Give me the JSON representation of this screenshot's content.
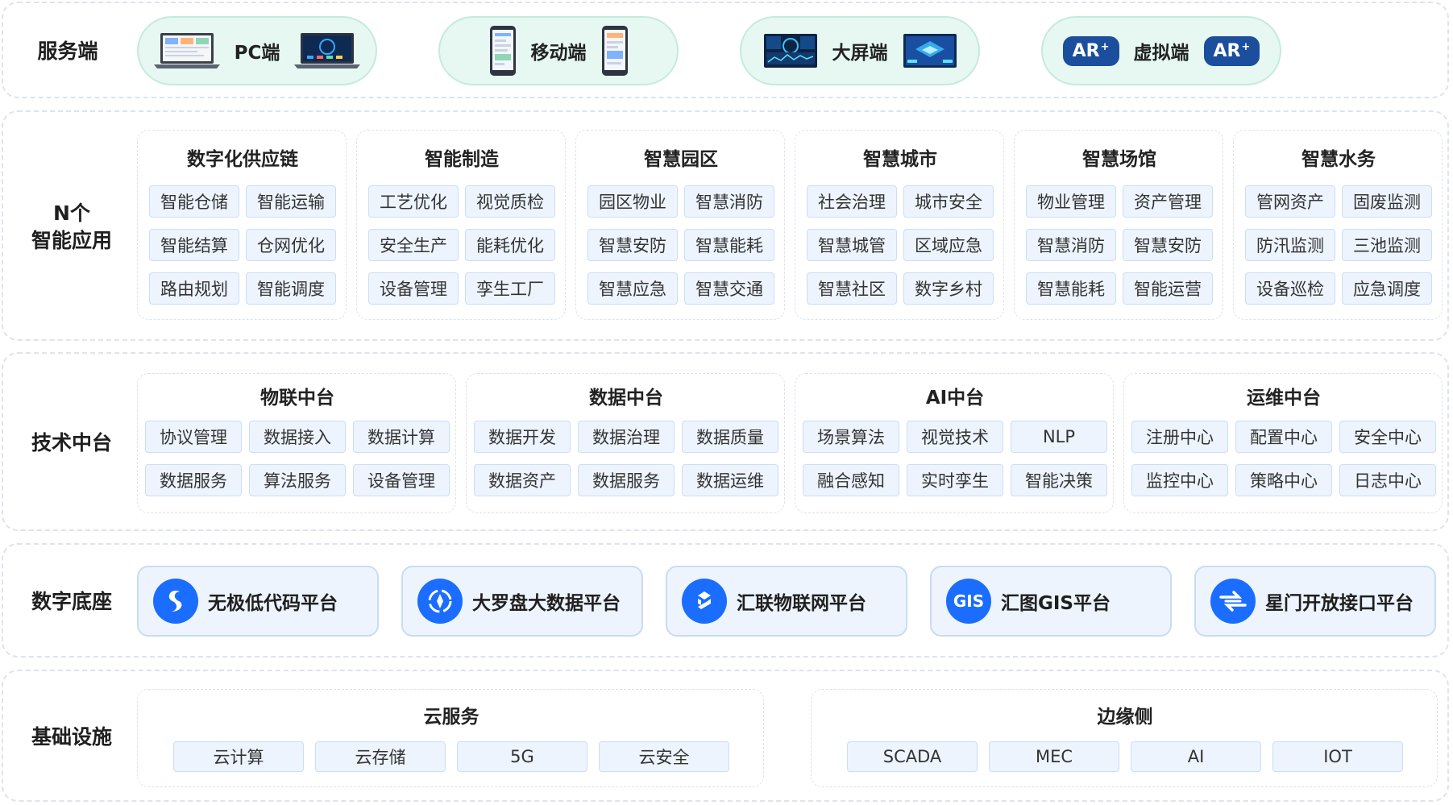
{
  "service": {
    "title": "服务端",
    "items": [
      {
        "label": "PC端",
        "icons": [
          "laptop-dashboard-icon",
          "laptop-dark-screen-icon"
        ]
      },
      {
        "label": "移动端",
        "icons": [
          "mobile-phone-icon",
          "mobile-phone-icon"
        ]
      },
      {
        "label": "大屏端",
        "icons": [
          "big-screen-icon",
          "big-screen-icon"
        ]
      },
      {
        "label": "虚拟端",
        "ar_text": "AR",
        "ar_sup": "+"
      }
    ]
  },
  "apps": {
    "title": "N个\n智能应用",
    "groups": [
      {
        "title": "数字化供应链",
        "items": [
          "智能仓储",
          "智能运输",
          "智能结算",
          "仓网优化",
          "路由规划",
          "智能调度"
        ]
      },
      {
        "title": "智能制造",
        "items": [
          "工艺优化",
          "视觉质检",
          "安全生产",
          "能耗优化",
          "设备管理",
          "孪生工厂"
        ]
      },
      {
        "title": "智慧园区",
        "items": [
          "园区物业",
          "智慧消防",
          "智慧安防",
          "智慧能耗",
          "智慧应急",
          "智慧交通"
        ]
      },
      {
        "title": "智慧城市",
        "items": [
          "社会治理",
          "城市安全",
          "智慧城管",
          "区域应急",
          "智慧社区",
          "数字乡村"
        ]
      },
      {
        "title": "智慧场馆",
        "items": [
          "物业管理",
          "资产管理",
          "智慧消防",
          "智慧安防",
          "智慧能耗",
          "智能运营"
        ]
      },
      {
        "title": "智慧水务",
        "items": [
          "管网资产",
          "固废监测",
          "防汛监测",
          "三池监测",
          "设备巡检",
          "应急调度"
        ]
      }
    ]
  },
  "tech": {
    "title": "技术中台",
    "groups": [
      {
        "title": "物联中台",
        "items": [
          "协议管理",
          "数据接入",
          "数据计算",
          "数据服务",
          "算法服务",
          "设备管理"
        ]
      },
      {
        "title": "数据中台",
        "items": [
          "数据开发",
          "数据治理",
          "数据质量",
          "数据资产",
          "数据服务",
          "数据运维"
        ]
      },
      {
        "title": "AI中台",
        "items": [
          "场景算法",
          "视觉技术",
          "NLP",
          "融合感知",
          "实时孪生",
          "智能决策"
        ]
      },
      {
        "title": "运维中台",
        "items": [
          "注册中心",
          "配置中心",
          "安全中心",
          "监控中心",
          "策略中心",
          "日志中心"
        ]
      }
    ]
  },
  "base": {
    "title": "数字底座",
    "items": [
      {
        "label": "无极低代码平台",
        "icon": "infinity-logo-icon"
      },
      {
        "label": "大罗盘大数据平台",
        "icon": "compass-logo-icon"
      },
      {
        "label": "汇联物联网平台",
        "icon": "iot-link-logo-icon"
      },
      {
        "label": "汇图GIS平台",
        "icon": "gis-logo-icon",
        "icon_text": "GIS"
      },
      {
        "label": "星门开放接口平台",
        "icon": "gateway-logo-icon"
      }
    ]
  },
  "infra": {
    "title": "基础设施",
    "groups": [
      {
        "title": "云服务",
        "items": [
          "云计算",
          "云存储",
          "5G",
          "云安全"
        ]
      },
      {
        "title": "边缘侧",
        "items": [
          "SCADA",
          "MEC",
          "AI",
          "IOT"
        ]
      }
    ]
  },
  "colors": {
    "accent_blue": "#1a6dff",
    "ar_badge": "#1b4f9d",
    "pill_green": "#e6f8f1",
    "chip_blue": "#edf4fd"
  }
}
